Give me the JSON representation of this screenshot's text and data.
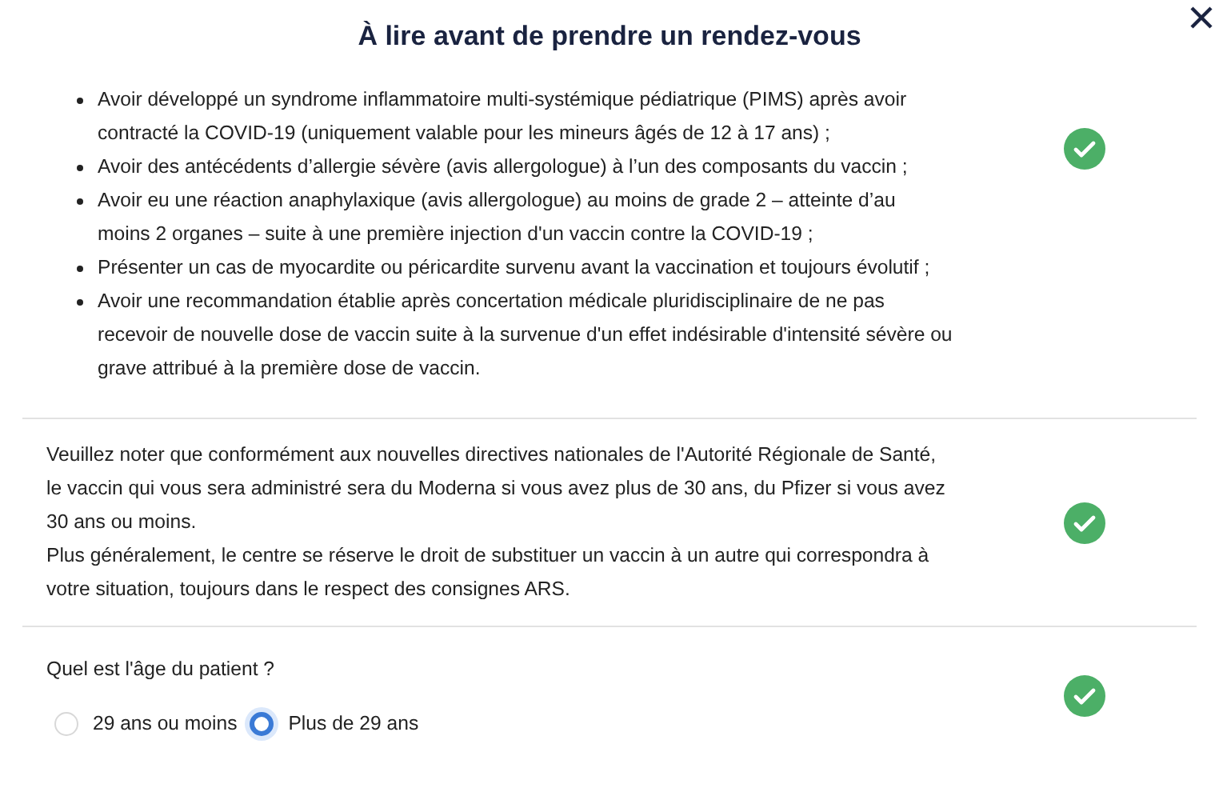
{
  "title": "À lire avant de prendre un rendez-vous",
  "sections": [
    {
      "kind": "list",
      "checked": true,
      "items": [
        "Avoir développé un syndrome inflammatoire multi-systémique pédiatrique (PIMS) après avoir contracté la COVID-19 (uniquement valable pour les mineurs âgés de 12 à 17 ans) ;",
        "Avoir des antécédents d’allergie sévère (avis allergologue) à l’un des composants du vaccin ;",
        "Avoir eu une réaction anaphylaxique (avis allergologue) au moins de grade 2 – atteinte d’au moins 2 organes – suite à une première injection d'un vaccin contre la COVID-19 ;",
        "Présenter un cas de myocardite ou péricardite survenu avant la vaccination et toujours évolutif ;",
        "Avoir une recommandation établie après concertation médicale pluridisciplinaire de ne pas recevoir de nouvelle dose de vaccin suite à la survenue d'un effet indésirable d'intensité sévère ou grave attribué à la première dose de vaccin."
      ]
    },
    {
      "kind": "text",
      "checked": true,
      "paragraphs": [
        "Veuillez noter que conformément aux nouvelles directives nationales de l'Autorité Régionale de Santé, le vaccin qui vous sera administré sera du Moderna si vous avez plus de 30 ans, du Pfizer si vous avez 30 ans ou moins.",
        "Plus généralement, le centre se réserve le droit de substituer un vaccin à un autre qui correspondra à votre situation, toujours dans le respect des consignes ARS."
      ]
    },
    {
      "kind": "question",
      "checked": true,
      "question": "Quel est l'âge du patient ?",
      "options": [
        {
          "label": "29 ans ou moins",
          "selected": false
        },
        {
          "label": "Plus de 29 ans",
          "selected": true
        }
      ]
    }
  ]
}
